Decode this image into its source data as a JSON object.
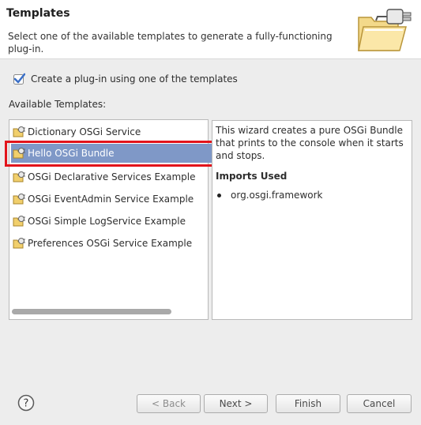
{
  "banner": {
    "title": "Templates",
    "description": "Select one of the available templates to generate a fully-functioning plug-in.",
    "icon": "folder-plugin-icon"
  },
  "option": {
    "checkbox_label": "Create a plug-in using one of the templates",
    "checked": true
  },
  "available_label": "Available Templates:",
  "templates": [
    {
      "label": "Dictionary OSGi Service",
      "icon": "template-icon"
    },
    {
      "label": "Hello OSGi Bundle",
      "icon": "template-icon",
      "selected": true
    },
    {
      "label": "OSGi Declarative Services Example",
      "icon": "template-icon"
    },
    {
      "label": "OSGi EventAdmin Service Example",
      "icon": "template-icon"
    },
    {
      "label": "OSGi Simple LogService Example",
      "icon": "template-icon"
    },
    {
      "label": "Preferences OSGi Service Example",
      "icon": "template-icon"
    }
  ],
  "details": {
    "text": "This wizard creates a pure OSGi Bundle that prints to the console when it starts and stops.",
    "imports_title": "Imports Used",
    "imports": [
      "org.osgi.framework"
    ]
  },
  "buttons": {
    "help": "?",
    "back": "< Back",
    "next": "Next >",
    "finish": "Finish",
    "cancel": "Cancel"
  },
  "colors": {
    "selection": "#7f98c7",
    "highlight_border": "#e2141b"
  }
}
